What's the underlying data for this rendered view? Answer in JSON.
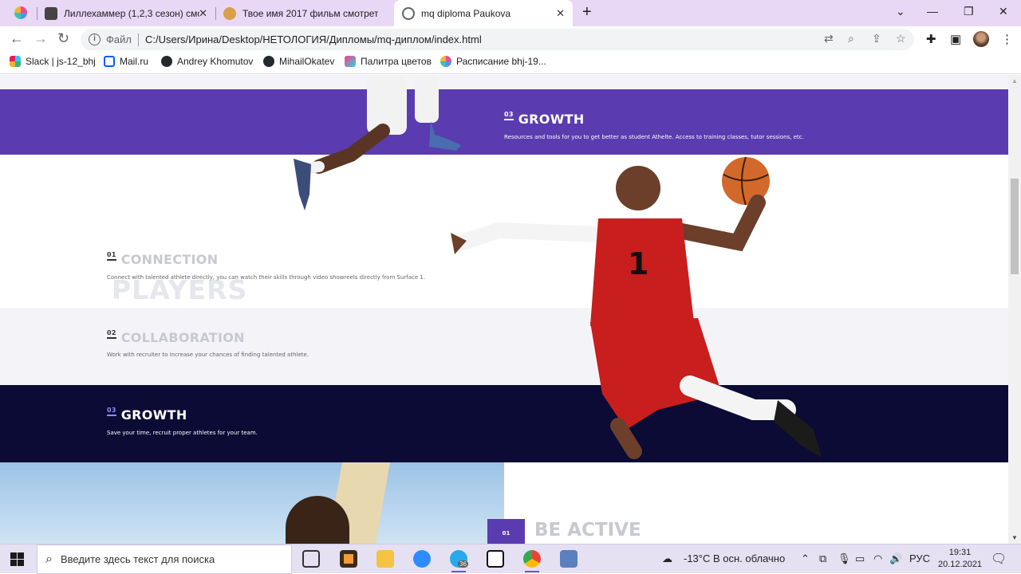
{
  "browser": {
    "tabs": [
      {
        "title": "Лиллехаммер (1,2,3 сезон) смо",
        "active": false
      },
      {
        "title": "Твое имя 2017 фильм смотреть",
        "active": false
      },
      {
        "title": "mq diploma Paukova",
        "active": true
      }
    ],
    "new_tab_label": "+",
    "address": {
      "scheme_label": "Файл",
      "url": "C:/Users/Ирина/Desktop/НЕТОЛОГИЯ/Дипломы/mq-диплом/index.html"
    },
    "bookmarks": [
      {
        "label": "Slack | js-12_bhj",
        "icon": "slack-icon"
      },
      {
        "label": "Mail.ru",
        "icon": "mail-icon"
      },
      {
        "label": "Andrey Khomutov",
        "icon": "github-icon"
      },
      {
        "label": "MihailOkatev",
        "icon": "github-icon"
      },
      {
        "label": "Палитра цветов",
        "icon": "palette-icon"
      },
      {
        "label": "Расписание bhj-19...",
        "icon": "schedule-icon"
      }
    ]
  },
  "page": {
    "growth_top": {
      "number": "03",
      "title": "GROWTH",
      "description": "Resources and tools for you to get better as student Athelte. Access to training classes, tutor sessions, etc."
    },
    "players": {
      "heading": "PLAYERS",
      "items": [
        {
          "number": "01",
          "title": "CONNECTION",
          "description": "Connect with talented athlete directly, you can watch their skills through video showreels directly from Surface 1."
        },
        {
          "number": "02",
          "title": "COLLABORATION",
          "description": "Work with recruiter to increase your chances of finding talented athlete."
        },
        {
          "number": "03",
          "title": "GROWTH",
          "description": "Save your time, recruit proper athletes for your team."
        }
      ]
    },
    "be_active": {
      "number": "01",
      "heading": "BE ACTIVE"
    },
    "player_jersey_number": "1",
    "colors": {
      "purple_band": "#5a3cb0",
      "navy_band": "#0b0b35",
      "light_band": "#f4f4f8",
      "muted_title": "#cfcfd8"
    }
  },
  "taskbar": {
    "search_placeholder": "Введите здесь текст для поиска",
    "telegram_badge": "36",
    "weather": "-13°C  В осн. облачно",
    "language": "РУС",
    "time": "19:31",
    "date": "20.12.2021"
  }
}
